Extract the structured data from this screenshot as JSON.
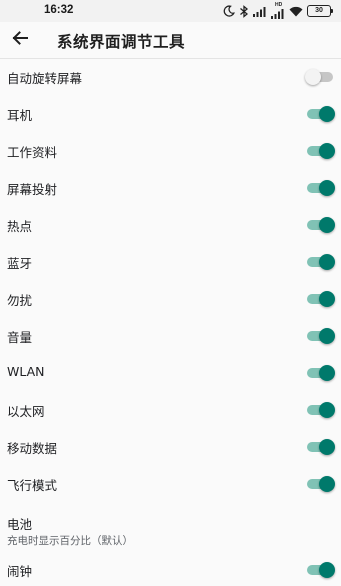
{
  "status_bar": {
    "time": "16:32",
    "network_label": "HD",
    "battery": "30"
  },
  "app_bar": {
    "title": "系统界面调节工具"
  },
  "items": [
    {
      "label": "自动旋转屏幕",
      "enabled": false
    },
    {
      "label": "耳机",
      "enabled": true
    },
    {
      "label": "工作资料",
      "enabled": true
    },
    {
      "label": "屏幕投射",
      "enabled": true
    },
    {
      "label": "热点",
      "enabled": true
    },
    {
      "label": "蓝牙",
      "enabled": true
    },
    {
      "label": "勿扰",
      "enabled": true
    },
    {
      "label": "音量",
      "enabled": true
    },
    {
      "label": "WLAN",
      "enabled": true
    },
    {
      "label": "以太网",
      "enabled": true
    },
    {
      "label": "移动数据",
      "enabled": true
    },
    {
      "label": "飞行模式",
      "enabled": true
    }
  ],
  "battery_item": {
    "label": "电池",
    "summary": "充电时显示百分比（默认）"
  },
  "alarm_item": {
    "label": "闹钟",
    "enabled": true
  },
  "colors": {
    "accent": "#00796b",
    "accent_track": "#80c2b5",
    "off_thumb": "#f3f3f3",
    "off_track": "#c6c6c6"
  }
}
